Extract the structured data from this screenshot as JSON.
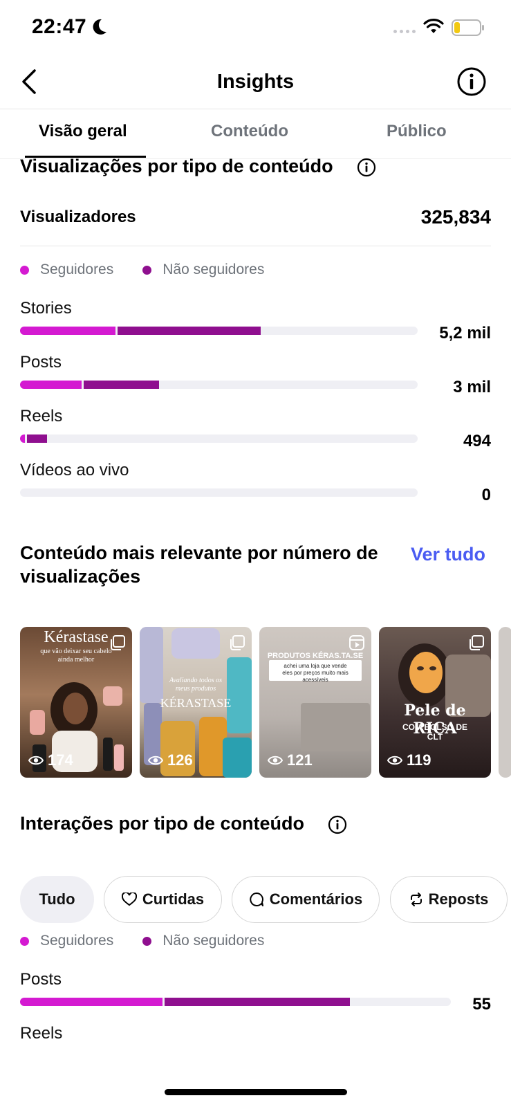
{
  "status_bar": {
    "time": "22:47"
  },
  "nav": {
    "title": "Insights"
  },
  "tabs": [
    {
      "label": "Visão geral",
      "active": true
    },
    {
      "label": "Conteúdo",
      "active": false
    },
    {
      "label": "Público",
      "active": false
    }
  ],
  "views_section": {
    "title": "Visualizações por tipo de conteúdo",
    "viewers_label": "Visualizadores",
    "viewers_value": "325,834",
    "legend": {
      "followers": "Seguidores",
      "non_followers": "Não seguidores"
    },
    "rows": [
      {
        "label": "Stories",
        "value": "5,2 mil",
        "followers_fraction": 0.24,
        "non_followers_fraction": 0.36
      },
      {
        "label": "Posts",
        "value": "3 mil",
        "followers_fraction": 0.155,
        "non_followers_fraction": 0.19
      },
      {
        "label": "Reels",
        "value": "494",
        "followers_fraction": 0.012,
        "non_followers_fraction": 0.05
      },
      {
        "label": "Vídeos ao vivo",
        "value": "0",
        "followers_fraction": 0,
        "non_followers_fraction": 0
      }
    ]
  },
  "top_content": {
    "title": "Conteúdo mais relevante por número de visualizações",
    "see_all": "Ver tudo",
    "items": [
      {
        "views": "174",
        "type_icon": "carousel-icon",
        "overlay_text": "que vão deixar seu cabelo ainda melhor",
        "brand_text": "Kérastase"
      },
      {
        "views": "126",
        "type_icon": "carousel-icon",
        "overlay_text": "Avaliando todos os meus produtos",
        "brand_text": "KÉRASTASE"
      },
      {
        "views": "121",
        "type_icon": "reels-icon",
        "overlay_text": "PRODUTOS KÉRAS.TA.SE",
        "caption": "achei uma loja que vende eles por preços muito mais acessíveis"
      },
      {
        "views": "119",
        "type_icon": "carousel-icon",
        "overlay_text": "Pele de RICA",
        "caption": "COM BOLSO DE CLT"
      }
    ]
  },
  "interactions_section": {
    "title": "Interações por tipo de conteúdo",
    "filters": [
      {
        "label": "Tudo",
        "icon": "",
        "active": true
      },
      {
        "label": "Curtidas",
        "icon": "heart-icon",
        "active": false
      },
      {
        "label": "Comentários",
        "icon": "comment-icon",
        "active": false
      },
      {
        "label": "Reposts",
        "icon": "repost-icon",
        "active": false
      }
    ],
    "legend": {
      "followers": "Seguidores",
      "non_followers": "Não seguidores"
    },
    "rows": [
      {
        "label": "Posts",
        "value": "55",
        "followers_fraction": 0.33,
        "non_followers_fraction": 0.43
      },
      {
        "label": "Reels",
        "value": "",
        "followers_fraction": 0,
        "non_followers_fraction": 0
      }
    ]
  },
  "colors": {
    "followers": "#d41ad1",
    "non_followers": "#8f0f8f",
    "track": "#efeff4",
    "link": "#4a5cf2"
  }
}
